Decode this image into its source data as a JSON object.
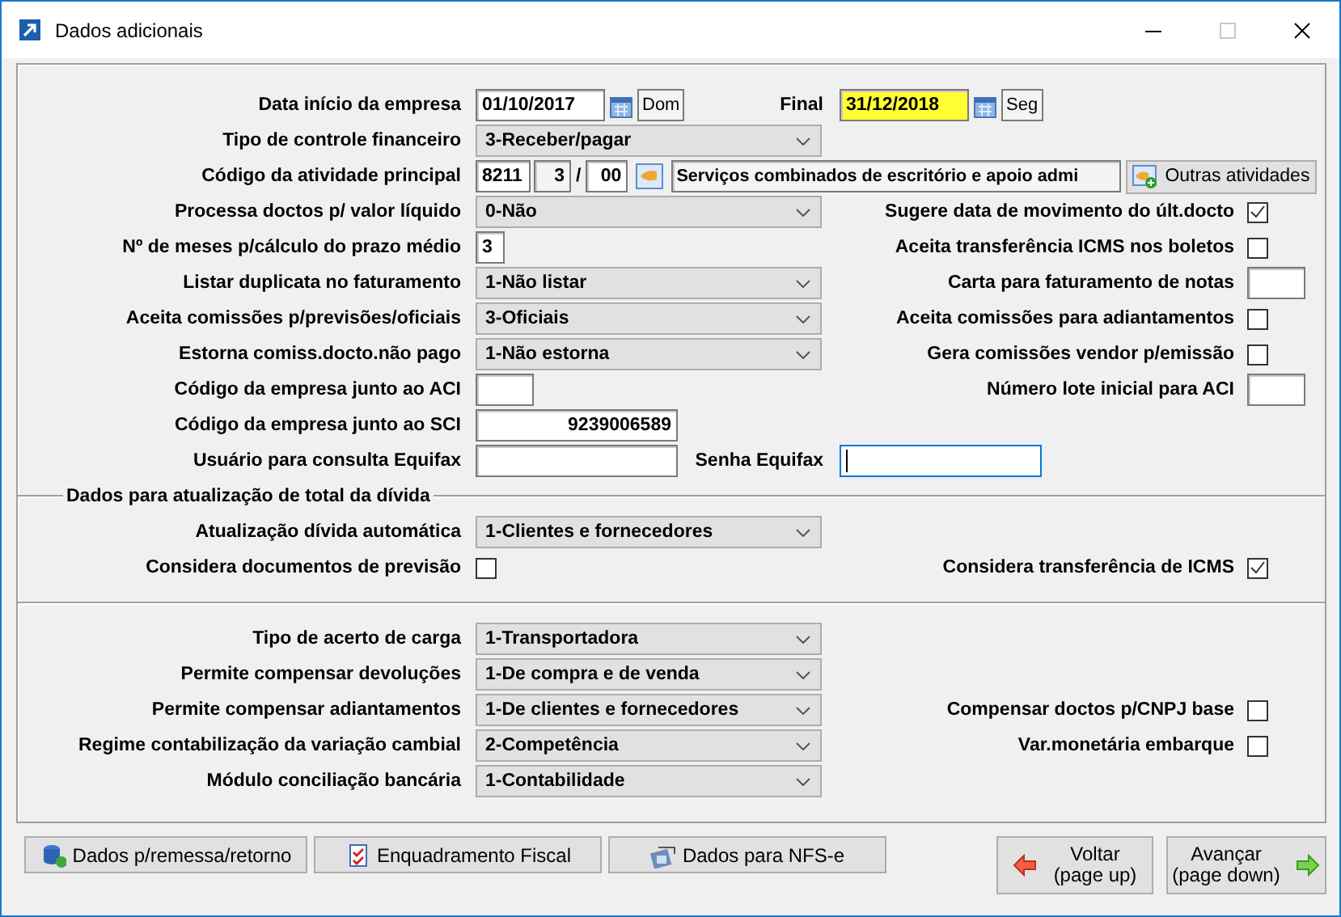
{
  "window": {
    "title": "Dados adicionais",
    "maximize_enabled": false
  },
  "sections": [
    {
      "rows": [
        {
          "label": "Data início da empresa",
          "control": {
            "kind": "date",
            "value": "01/10/2017",
            "weekday": "Dom",
            "highlighted": false
          },
          "middle": {
            "label": "Final",
            "control": {
              "kind": "date",
              "value": "31/12/2018",
              "weekday": "Seg",
              "highlighted": true
            }
          }
        },
        {
          "label": "Tipo de controle financeiro",
          "control": {
            "kind": "combo",
            "value": "3-Receber/pagar"
          }
        },
        {
          "label": "Código da atividade principal",
          "control": {
            "kind": "activity",
            "code": "8211",
            "digit": "3",
            "separator": "/",
            "suffix": "00",
            "description": "Serviços combinados de escritório e apoio admi",
            "button": "Outras atividades"
          }
        },
        {
          "label": "Processa doctos p/ valor líquido",
          "control": {
            "kind": "combo",
            "value": "0-Não"
          },
          "right": {
            "label": "Sugere data de movimento do últ.docto",
            "control": {
              "kind": "checkbox",
              "checked": true
            }
          }
        },
        {
          "label": "Nº de meses p/cálculo do prazo médio",
          "control": {
            "kind": "digit_field",
            "value": "3",
            "focused": false
          },
          "right": {
            "label": "Aceita transferência ICMS nos boletos",
            "control": {
              "kind": "checkbox",
              "checked": false
            }
          }
        },
        {
          "label": "Listar duplicata no faturamento",
          "control": {
            "kind": "combo",
            "value": "1-Não listar"
          },
          "right": {
            "label": "Carta para faturamento de notas",
            "control": {
              "kind": "short_field",
              "focused": false
            }
          }
        },
        {
          "label": "Aceita comissões p/previsões/oficiais",
          "control": {
            "kind": "combo",
            "value": "3-Oficiais"
          },
          "right": {
            "label": "Aceita comissões para adiantamentos",
            "control": {
              "kind": "checkbox",
              "checked": false
            }
          }
        },
        {
          "label": "Estorna comiss.docto.não pago",
          "control": {
            "kind": "combo",
            "value": "1-Não estorna"
          },
          "right": {
            "label": "Gera comissões vendor p/emissão",
            "control": {
              "kind": "checkbox",
              "checked": false
            }
          }
        },
        {
          "label": "Código da empresa junto ao ACI",
          "control": {
            "kind": "short_field",
            "focused": false
          },
          "right": {
            "label": "Número lote inicial para ACI",
            "control": {
              "kind": "short_field",
              "focused": false
            }
          }
        },
        {
          "label": "Código da empresa junto ao SCI",
          "control": {
            "kind": "number_field",
            "value": "9239006589",
            "focused": false
          }
        },
        {
          "label": "Usuário para consulta Equifax",
          "control": {
            "kind": "text_field",
            "focused": false
          },
          "middle": {
            "label": "Senha Equifax",
            "control": {
              "kind": "text_field",
              "focused": true
            }
          }
        }
      ]
    },
    {
      "title": "Dados para atualização de total da dívida",
      "rows": [
        {
          "label": "Atualização dívida automática",
          "control": {
            "kind": "combo",
            "value": "1-Clientes e fornecedores"
          }
        },
        {
          "label": "Considera documentos de previsão",
          "control": {
            "kind": "checkbox",
            "checked": false
          },
          "right": {
            "label": "Considera transferência de ICMS",
            "control": {
              "kind": "checkbox",
              "checked": true
            }
          }
        }
      ]
    },
    {
      "rows": [
        {
          "label": "Tipo de acerto de carga",
          "control": {
            "kind": "combo",
            "value": "1-Transportadora"
          }
        },
        {
          "label": "Permite compensar devoluções",
          "control": {
            "kind": "combo",
            "value": "1-De compra e de venda"
          }
        },
        {
          "label": "Permite compensar adiantamentos",
          "control": {
            "kind": "combo",
            "value": "1-De clientes e fornecedores"
          },
          "right": {
            "label": "Compensar doctos p/CNPJ base",
            "control": {
              "kind": "checkbox",
              "checked": false
            }
          }
        },
        {
          "label": "Regime contabilização da variação cambial",
          "control": {
            "kind": "combo",
            "value": "2-Competência"
          },
          "right": {
            "label": "Var.monetária embarque",
            "control": {
              "kind": "checkbox",
              "checked": false
            }
          }
        },
        {
          "label": "Módulo conciliação bancária",
          "control": {
            "kind": "combo",
            "value": "1-Contabilidade"
          }
        }
      ]
    }
  ],
  "actions": [
    {
      "label": "Dados p/remessa/retorno",
      "kind": "database"
    },
    {
      "label": "Enquadramento Fiscal",
      "kind": "checklist"
    },
    {
      "label": "Dados para NFS-e",
      "kind": "document"
    }
  ],
  "navigation": [
    {
      "label": "Voltar",
      "hint": "(page up)",
      "kind": "back"
    },
    {
      "label": "Avançar",
      "hint": "(page down)",
      "kind": "forward"
    }
  ]
}
